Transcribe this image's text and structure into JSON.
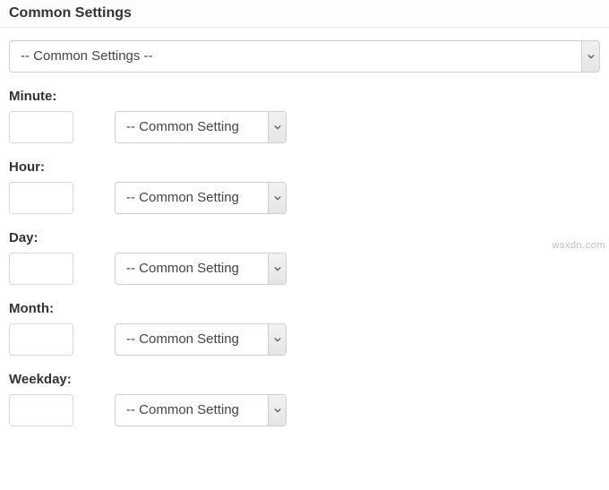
{
  "section": {
    "title": "Common Settings"
  },
  "common_select": {
    "display": "-- Common Settings --"
  },
  "fields": {
    "minute": {
      "label": "Minute:",
      "value": "",
      "select_display": "-- Common Setting"
    },
    "hour": {
      "label": "Hour:",
      "value": "",
      "select_display": "-- Common Setting"
    },
    "day": {
      "label": "Day:",
      "value": "",
      "select_display": "-- Common Setting"
    },
    "month": {
      "label": "Month:",
      "value": "",
      "select_display": "-- Common Setting"
    },
    "weekday": {
      "label": "Weekday:",
      "value": "",
      "select_display": "-- Common Setting"
    }
  },
  "watermark": "wsxdn.com"
}
